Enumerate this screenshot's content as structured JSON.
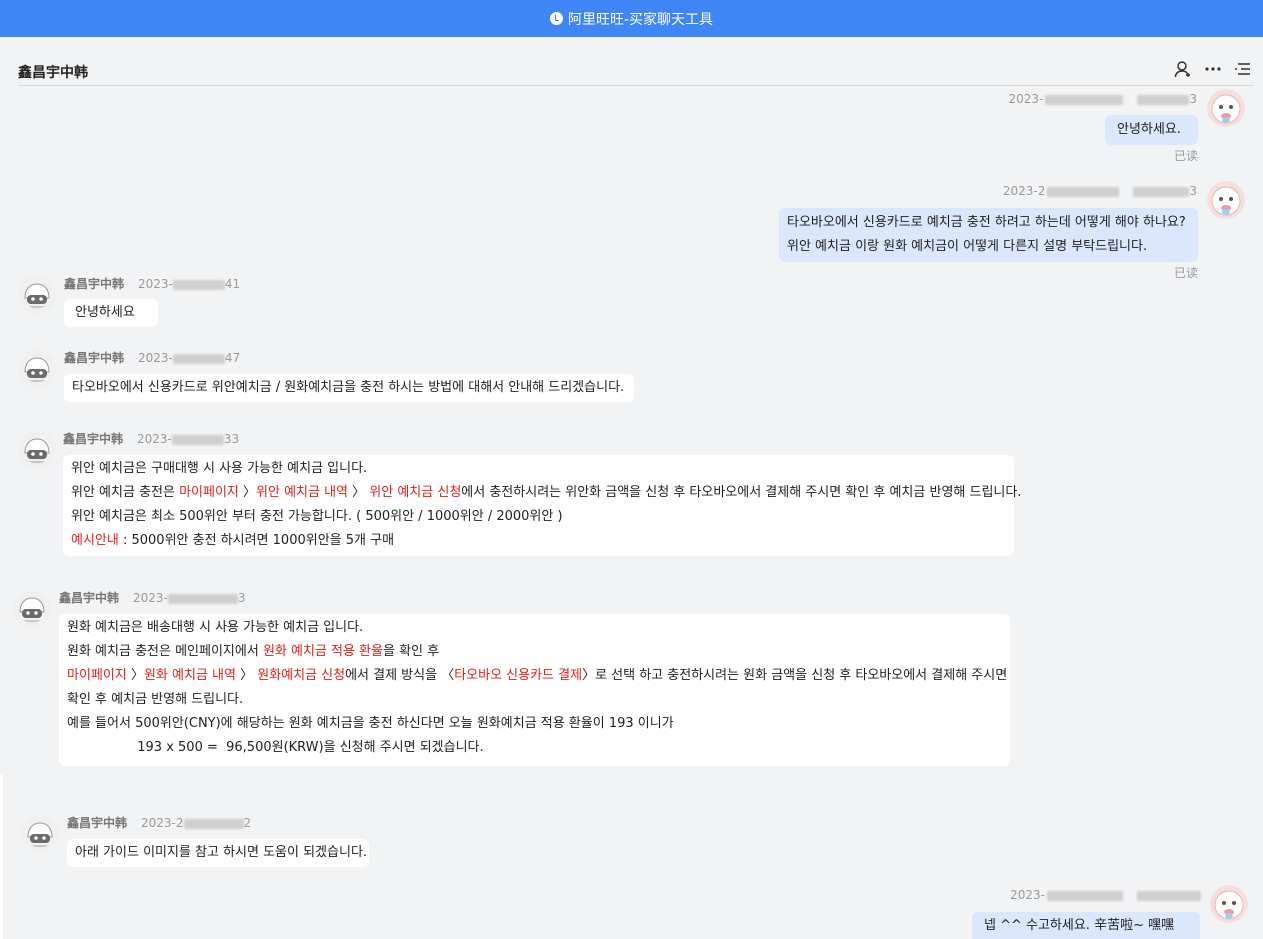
{
  "window": {
    "title": "阿里旺旺-买家聊天工具"
  },
  "header": {
    "contact_name": "鑫昌宇中韩"
  },
  "messages": [
    {
      "side": "self",
      "time_prefix": "2023-",
      "time_suffix": "3",
      "lines": [
        "안녕하세요."
      ],
      "read": "已读"
    },
    {
      "side": "self",
      "time_prefix": "2023-2",
      "time_suffix": "3",
      "lines": [
        "타오바오에서 신용카드로 예치금 충전 하려고 하는데 어떻게 해야 하나요?",
        "위안 예치금 이랑 원화 예치금이 어떻게 다른지 설명 부탁드립니다."
      ],
      "read": "已读"
    },
    {
      "side": "other",
      "sender": "鑫昌宇中韩",
      "time_prefix": "2023-",
      "time_suffix": "41",
      "lines": [
        "안녕하세요"
      ]
    },
    {
      "side": "other",
      "sender": "鑫昌宇中韩",
      "time_prefix": "2023-",
      "time_suffix": "47",
      "lines": [
        "타오바오에서 신용카드로 위안예치금 / 원화예치금을 충전 하시는 방법에 대해서 안내해 드리겠습니다."
      ]
    },
    {
      "side": "other",
      "sender": "鑫昌宇中韩",
      "time_prefix": "2023-",
      "time_suffix": "33",
      "rich": [
        [
          "위안 예치금은 구매대행 시 사용 가능한 예치금 입니다."
        ],
        [
          "위안 예치금 충전은 ",
          {
            "r": "마이페이지"
          },
          " 〉",
          {
            "r": "위안 예치금 내역"
          },
          " 〉 ",
          {
            "r": "위안 예치금 신청"
          },
          "에서  충전하시려는 위안화 금액을 신청 후 타오바오에서 결제해 주시면 확인 후 예치금 반영해 드립니다."
        ],
        [
          "위안 예치금은 최소 500위안 부터 충전 가능합니다. ( 500위안  /  1000위안  /  2000위안  )"
        ],
        [
          {
            "r": "예시안내"
          },
          " : 5000위안 충전 하시려면 1000위안을 5개 구매"
        ]
      ]
    },
    {
      "side": "other",
      "sender": "鑫昌宇中韩",
      "time_prefix": "2023-",
      "time_suffix": "3",
      "rich": [
        [
          "원화 예치금은 배송대행 시 사용 가능한 예치금 입니다."
        ],
        [
          "원화 예치금 충전은  메인페이지에서 ",
          {
            "r": "원화 예치금 적용 환율"
          },
          "을 확인 후"
        ],
        [
          {
            "r": "마이페이지"
          },
          " 〉",
          {
            "r": "원화 예치금 내역"
          },
          " 〉 ",
          {
            "r": "원화예치금 신청"
          },
          "에서  결제 방식을 〈",
          {
            "r": "타오바오 신용카드 결제"
          },
          "〉로 선택 하고 충전하시려는 원화 금액을 신청 후 타오바오에서 결제해 주시면"
        ],
        [
          "확인 후 예치금 반영해 드립니다."
        ],
        [
          "예를 들어서 500위안(CNY)에 해당하는 원화 예치금을 충전 하신다면 오늘 원화예치금 적용 환율이 193 이니가"
        ],
        [
          "                 193 x 500 =  96,500원(KRW)을 신청해 주시면 되겠습니다."
        ]
      ]
    },
    {
      "side": "other",
      "sender": "鑫昌宇中韩",
      "time_prefix": "2023-2",
      "time_suffix": "2",
      "lines": [
        "아래 가이드 이미지를 참고 하시면 도움이 되겠습니다."
      ]
    },
    {
      "side": "self",
      "time_prefix": "2023-",
      "time_suffix": "",
      "lines": [
        "넵  ^^ 수고하세요. 辛苦啦~ 嘿嘿"
      ]
    }
  ]
}
